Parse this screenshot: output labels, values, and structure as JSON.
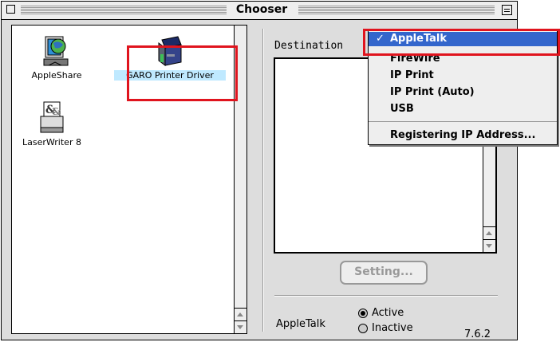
{
  "window": {
    "title": "Chooser"
  },
  "drivers": [
    {
      "label": "AppleShare",
      "icon": "appleshare-icon"
    },
    {
      "label": "GARO Printer Driver",
      "icon": "printer-icon"
    },
    {
      "label": "LaserWriter 8",
      "icon": "laserwriter-icon"
    }
  ],
  "destination": {
    "label": "Destination"
  },
  "setting_button": {
    "label": "Setting..."
  },
  "appletalk": {
    "label": "AppleTalk",
    "options": [
      {
        "label": "Active",
        "selected": true
      },
      {
        "label": "Inactive",
        "selected": false
      }
    ]
  },
  "version": "7.6.2",
  "dropdown": {
    "items": [
      {
        "label": "AppleTalk",
        "checked": true
      },
      {
        "label": "FireWire"
      },
      {
        "label": "IP Print"
      },
      {
        "label": "IP Print (Auto)"
      },
      {
        "label": "USB"
      },
      {
        "label": "Registering IP Address..."
      }
    ],
    "checkmark": "✓"
  },
  "colors": {
    "highlight_box": "#e0141e",
    "selected_item": "#3366cc",
    "selected_driver_label": "#bfe9ff"
  }
}
